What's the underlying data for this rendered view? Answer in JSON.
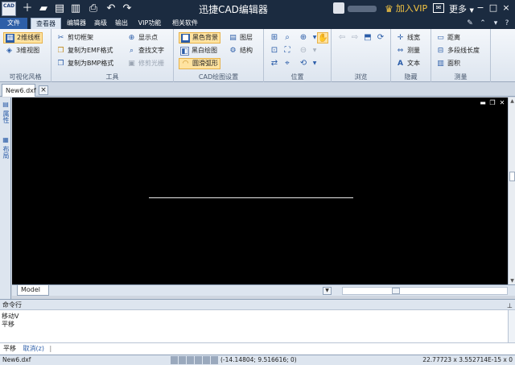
{
  "titlebar": {
    "app_logo": "CAD",
    "title": "迅捷CAD编辑器",
    "vip_label": "加入VIP",
    "more_label": "更多",
    "quick_access": [
      "new-file-icon",
      "open-folder-icon",
      "save-icon",
      "save-as-icon",
      "print-icon",
      "undo-icon",
      "redo-icon"
    ]
  },
  "menu": {
    "file": "文件",
    "tabs": [
      "查看器",
      "编辑器",
      "高级",
      "输出",
      "VIP功能",
      "相关软件"
    ],
    "active_tab": "查看器"
  },
  "ribbon": {
    "visual_style": {
      "label": "可视化风格",
      "wireframe_2d": "2维线框",
      "view_3d": "3维视图"
    },
    "tools": {
      "label": "工具",
      "clip_frame": "剪切框架",
      "copy_emf": "复制为EMF格式",
      "copy_bmp": "复制为BMP格式",
      "show_points": "显示点",
      "find_text": "查找文字",
      "trim_raster": "修剪光栅"
    },
    "cad_settings": {
      "label": "CAD绘图设置",
      "black_bg": "黑色背景",
      "bw_drawing": "黑白绘图",
      "smooth_arc": "圆滑弧形",
      "layers": "图层",
      "structure": "结构"
    },
    "position": {
      "label": "位置"
    },
    "browse": {
      "label": "浏览"
    },
    "hide": {
      "label": "隐藏",
      "line_width": "线宽",
      "measure": "测量",
      "text": "文本"
    },
    "measure": {
      "label": "测量",
      "distance": "距离",
      "polyline_length": "多段线长度",
      "area": "面积"
    }
  },
  "document": {
    "tab_name": "New6.dxf",
    "close": "×",
    "model_tab": "Model"
  },
  "side_panel": {
    "properties": "属性",
    "layouts": "布局"
  },
  "command": {
    "header": "命令行",
    "lines": [
      "移动V",
      "平移"
    ],
    "prompt": "平移",
    "cancel": "取消(z)",
    "separator": "|"
  },
  "status": {
    "file": "New6.dxf",
    "coords": "(-14.14804; 9.516616; 0)",
    "coords2": "22.77723 x 3.552714E-15 x 0"
  },
  "colors": {
    "titlebar": "#1b2b40",
    "canvas": "#000000",
    "accent_blue": "#2a5ca8",
    "selected": "#ffe3a0"
  }
}
